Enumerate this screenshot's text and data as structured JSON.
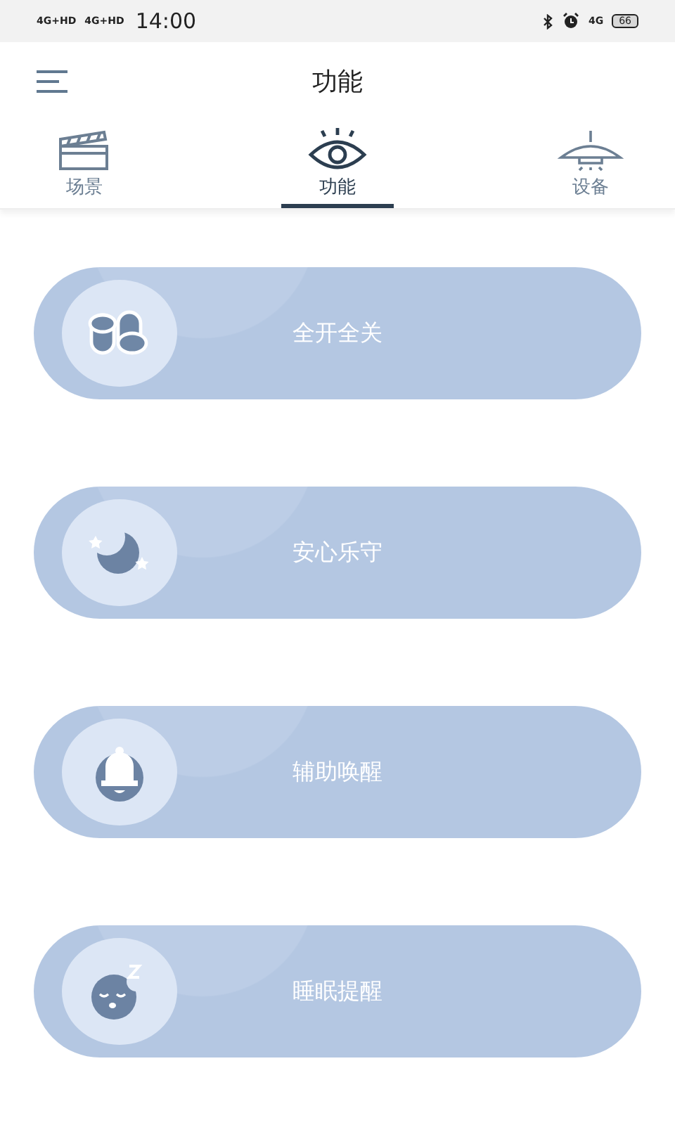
{
  "status_bar": {
    "networks": [
      "4G+HD",
      "4G+HD"
    ],
    "time": "14:00",
    "data_network": "4G",
    "battery": "66"
  },
  "header": {
    "title": "功能"
  },
  "tabs": [
    {
      "label": "场景",
      "kind": "clapper",
      "selected": false
    },
    {
      "label": "功能",
      "kind": "eye",
      "selected": true
    },
    {
      "label": "设备",
      "kind": "lamp",
      "selected": false
    }
  ],
  "functions": [
    {
      "label": "全开全关",
      "kind": "cylinders"
    },
    {
      "label": "安心乐守",
      "kind": "moon"
    },
    {
      "label": "辅助唤醒",
      "kind": "bell"
    },
    {
      "label": "睡眠提醒",
      "kind": "sleep"
    }
  ]
}
